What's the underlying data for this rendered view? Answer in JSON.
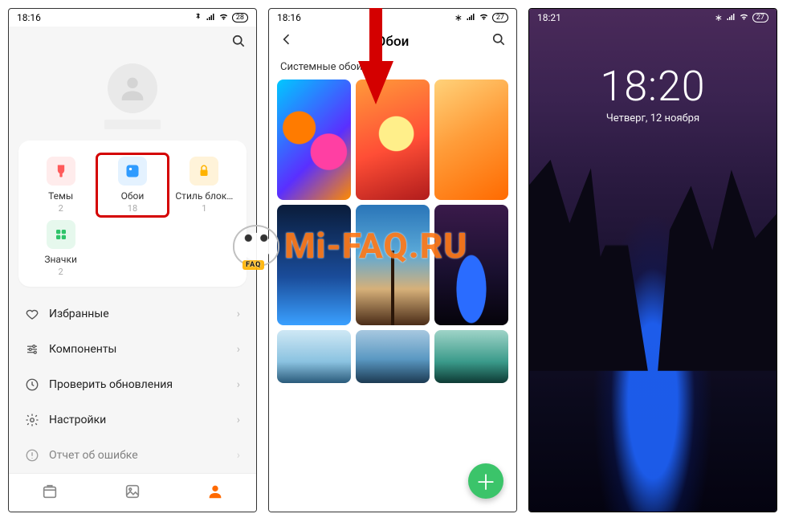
{
  "watermark_text": "Mi-FAQ.RU",
  "screen1": {
    "status": {
      "time": "18:16",
      "battery": "28"
    },
    "tiles": [
      {
        "label": "Темы",
        "count": "2"
      },
      {
        "label": "Обои",
        "count": "18"
      },
      {
        "label": "Стиль блок…",
        "count": "1"
      },
      {
        "label": "Значки",
        "count": "2"
      }
    ],
    "menu": [
      "Избранные",
      "Компоненты",
      "Проверить обновления",
      "Настройки",
      "Отчет об ошибке"
    ]
  },
  "screen2": {
    "status": {
      "time": "18:16",
      "battery": "27"
    },
    "title": "Обои",
    "section": "Системные обои"
  },
  "screen3": {
    "status": {
      "time": "18:21",
      "battery": "27"
    },
    "clock": "18:20",
    "date": "Четверг, 12 ноября"
  }
}
